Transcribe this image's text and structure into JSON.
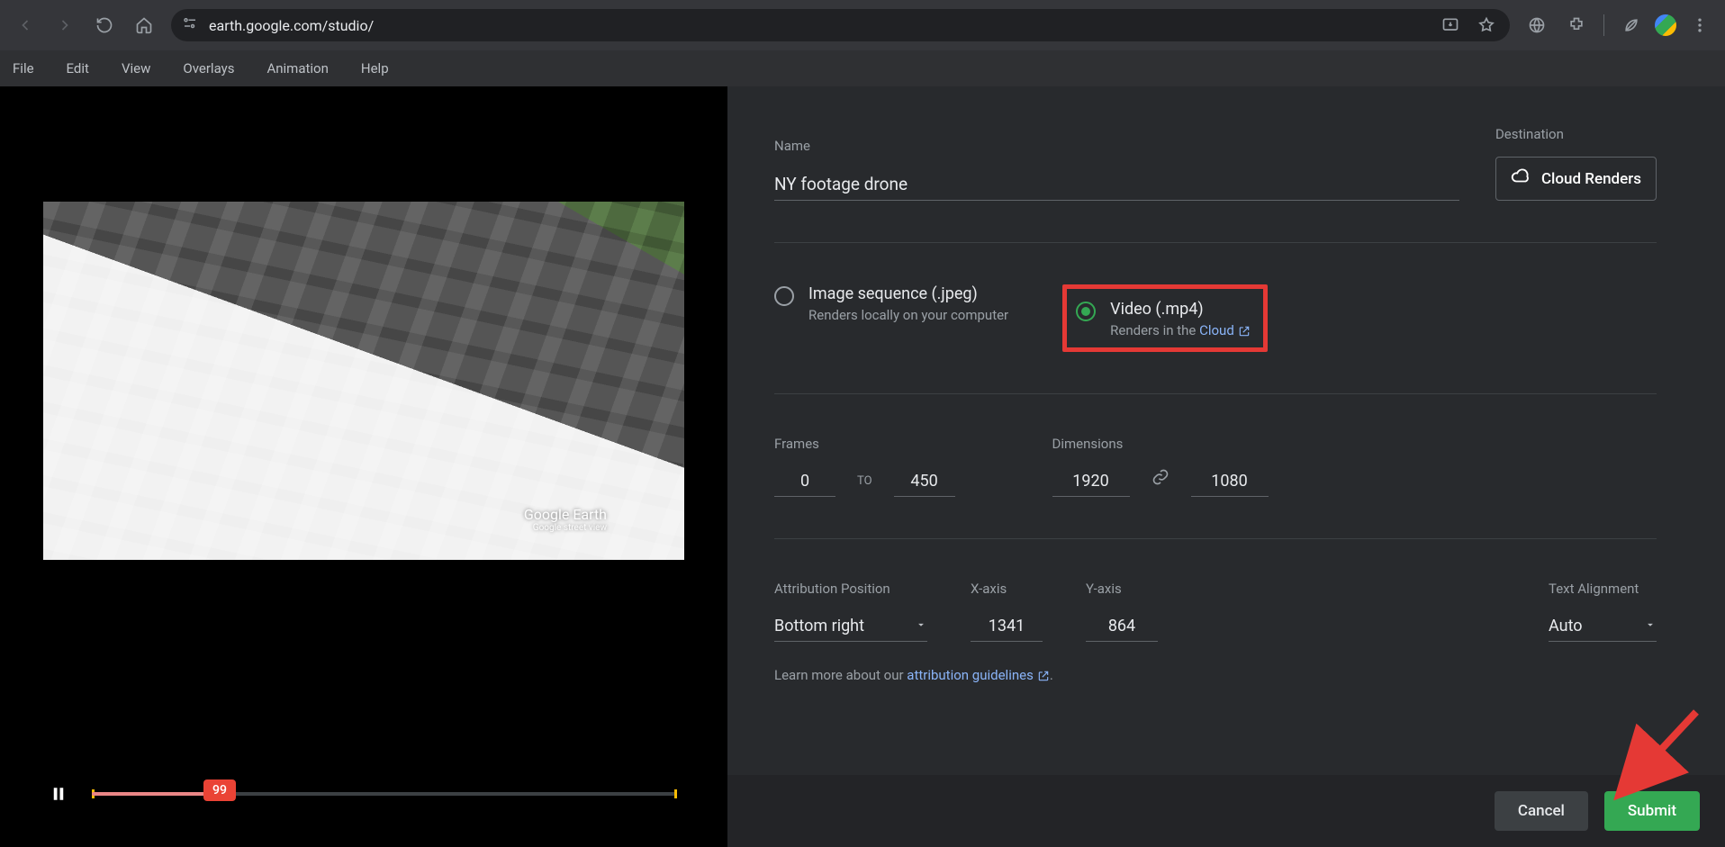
{
  "browser": {
    "url": "earth.google.com/studio/"
  },
  "menu": {
    "file": "File",
    "edit": "Edit",
    "view": "View",
    "overlays": "Overlays",
    "animation": "Animation",
    "help": "Help"
  },
  "preview": {
    "attribution_title": "Google Earth",
    "attribution_sub": "Google street view",
    "current_frame": "99"
  },
  "export": {
    "name_label": "Name",
    "name_value": "NY footage drone",
    "destination_label": "Destination",
    "destination_button": "Cloud Renders",
    "format": {
      "image_title": "Image sequence (.jpeg)",
      "image_sub": "Renders locally on your computer",
      "video_title": "Video (.mp4)",
      "video_sub_prefix": "Renders in the ",
      "video_sub_link": "Cloud"
    },
    "frames_label": "Frames",
    "frame_from": "0",
    "frame_to_label": "TO",
    "frame_to": "450",
    "dimensions_label": "Dimensions",
    "dim_w": "1920",
    "dim_h": "1080",
    "attr_pos_label": "Attribution Position",
    "attr_pos_value": "Bottom right",
    "xaxis_label": "X-axis",
    "xaxis_value": "1341",
    "yaxis_label": "Y-axis",
    "yaxis_value": "864",
    "text_align_label": "Text Alignment",
    "text_align_value": "Auto",
    "learn_prefix": "Learn more about our ",
    "learn_link": "attribution guidelines",
    "learn_suffix": ".",
    "cancel": "Cancel",
    "submit": "Submit"
  }
}
